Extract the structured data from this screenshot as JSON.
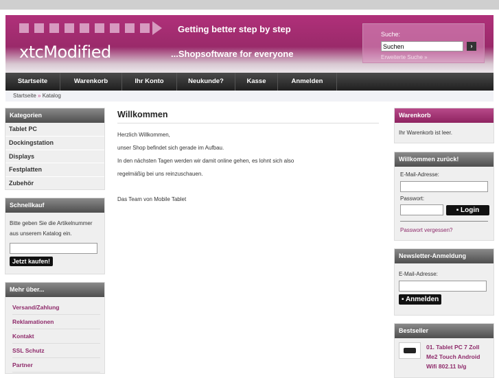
{
  "header": {
    "logo": "xtcModified",
    "slogan1": "Getting better step by step",
    "slogan2": "...Shopsoftware for everyone",
    "search_label": "Suche:",
    "search_value": "Suchen",
    "search_button": "›",
    "advanced_search": "Erweiterte Suche »"
  },
  "nav": [
    {
      "label": "Startseite"
    },
    {
      "label": "Warenkorb"
    },
    {
      "label": "Ihr Konto"
    },
    {
      "label": "Neukunde?"
    },
    {
      "label": "Kasse"
    },
    {
      "label": "Anmelden"
    }
  ],
  "breadcrumb": {
    "home": "Startseite",
    "sep": "»",
    "current": "Katalog"
  },
  "categories": {
    "title": "Kategorien",
    "items": [
      "Tablet PC",
      "Dockingstation",
      "Displays",
      "Festplatten",
      "Zubehör"
    ]
  },
  "quickbuy": {
    "title": "Schnellkauf",
    "text": "Bitte geben Sie die Artikelnummer aus unserem Katalog ein.",
    "button": "Jetzt kaufen!"
  },
  "more": {
    "title": "Mehr über...",
    "items": [
      "Versand/Zahlung",
      "Reklamationen",
      "Kontakt",
      "SSL Schutz",
      "Partner"
    ]
  },
  "main": {
    "title": "Willkommen",
    "lines": [
      "Herzlich Willkommen,",
      "unser Shop befindet sich gerade im Aufbau.",
      "In den nächsten Tagen werden wir damit online gehen, es lohnt sich also",
      "regelmäßig bei uns reinzuschauen."
    ],
    "signature": "Das Team von Mobile Tablet"
  },
  "cart": {
    "title": "Warenkorb",
    "text": "Ihr Warenkorb ist leer."
  },
  "login": {
    "title": "Willkommen zurück!",
    "email_label": "E-Mail-Adresse:",
    "password_label": "Passwort:",
    "button": "Login",
    "forgot": "Passwort vergessen?"
  },
  "newsletter": {
    "title": "Newsletter-Anmeldung",
    "email_label": "E-Mail-Adresse:",
    "button": "Anmelden"
  },
  "bestseller": {
    "title": "Bestseller",
    "items": [
      {
        "rank": "01.",
        "name": "Tablet PC 7 Zoll Me2 Touch Android Wifi 802.11 b/g"
      }
    ]
  }
}
